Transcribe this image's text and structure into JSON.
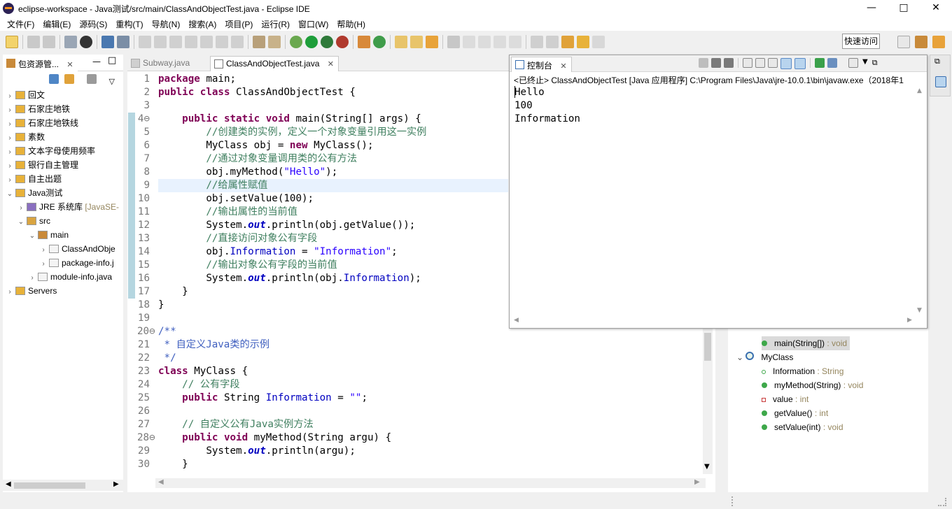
{
  "window": {
    "title": "eclipse-workspace - Java测试/src/main/ClassAndObjectTest.java - Eclipse IDE",
    "minimize_glyph": "—",
    "maximize_glyph": "□",
    "close_glyph": "✕"
  },
  "menu": [
    "文件(F)",
    "编辑(E)",
    "源码(S)",
    "重构(T)",
    "导航(N)",
    "搜索(A)",
    "项目(P)",
    "运行(R)",
    "窗口(W)",
    "帮助(H)"
  ],
  "toolbar": {
    "quick_access": "快速访问"
  },
  "package_explorer": {
    "tab_label": "包资源管...",
    "items": [
      {
        "label": "回文",
        "depth": 0,
        "expanded": false,
        "kind": "project"
      },
      {
        "label": "石家庄地铁",
        "depth": 0,
        "expanded": false,
        "kind": "project"
      },
      {
        "label": "石家庄地铁线",
        "depth": 0,
        "expanded": false,
        "kind": "project"
      },
      {
        "label": "素数",
        "depth": 0,
        "expanded": false,
        "kind": "project"
      },
      {
        "label": "文本字母使用频率",
        "depth": 0,
        "expanded": false,
        "kind": "project"
      },
      {
        "label": "银行自主管理",
        "depth": 0,
        "expanded": false,
        "kind": "project"
      },
      {
        "label": "自主出题",
        "depth": 0,
        "expanded": false,
        "kind": "project"
      },
      {
        "label": "Java测试",
        "depth": 0,
        "expanded": true,
        "kind": "project"
      },
      {
        "label": "JRE 系统库",
        "suffix": "[JavaSE-",
        "depth": 1,
        "expanded": false,
        "kind": "library"
      },
      {
        "label": "src",
        "depth": 1,
        "expanded": true,
        "kind": "folder"
      },
      {
        "label": "main",
        "depth": 2,
        "expanded": true,
        "kind": "package"
      },
      {
        "label": "ClassAndObje",
        "depth": 3,
        "expanded": false,
        "kind": "file"
      },
      {
        "label": "package-info.j",
        "depth": 3,
        "expanded": false,
        "kind": "file"
      },
      {
        "label": "module-info.java",
        "depth": 2,
        "expanded": false,
        "kind": "file"
      },
      {
        "label": "Servers",
        "depth": 0,
        "expanded": false,
        "kind": "project"
      }
    ]
  },
  "editor": {
    "tabs": [
      "Subway.java",
      "ClassAndObjectTest.java"
    ],
    "active_tab": "ClassAndObjectTest.java",
    "close_glyph": "✕",
    "lines": [
      {
        "n": "1",
        "segs": [
          [
            "kw",
            "package"
          ],
          [
            "p",
            " main;"
          ]
        ]
      },
      {
        "n": "2",
        "segs": [
          [
            "kw",
            "public"
          ],
          [
            "p",
            " "
          ],
          [
            "kw",
            "class"
          ],
          [
            "p",
            " ClassAndObjectTest {"
          ]
        ]
      },
      {
        "n": "3",
        "segs": []
      },
      {
        "n": "4⊖",
        "segs": [
          [
            "p",
            "    "
          ],
          [
            "kw",
            "public"
          ],
          [
            "p",
            " "
          ],
          [
            "kw",
            "static"
          ],
          [
            "p",
            " "
          ],
          [
            "kw",
            "void"
          ],
          [
            "p",
            " main(String[] args) {"
          ]
        ]
      },
      {
        "n": "5",
        "segs": [
          [
            "p",
            "        "
          ],
          [
            "cmt",
            "//创建类的实例，定义一个对象变量引用这一实例"
          ]
        ]
      },
      {
        "n": "6",
        "segs": [
          [
            "p",
            "        MyClass obj = "
          ],
          [
            "kw",
            "new"
          ],
          [
            "p",
            " MyClass();"
          ]
        ]
      },
      {
        "n": "7",
        "segs": [
          [
            "p",
            "        "
          ],
          [
            "cmt",
            "//通过对象变量调用类的公有方法"
          ]
        ]
      },
      {
        "n": "8",
        "segs": [
          [
            "p",
            "        obj.myMethod("
          ],
          [
            "str",
            "\"Hello\""
          ],
          [
            "p",
            ");"
          ]
        ]
      },
      {
        "n": "9",
        "segs": [
          [
            "p",
            "        "
          ],
          [
            "cmt",
            "//给属性赋值"
          ]
        ]
      },
      {
        "n": "10",
        "segs": [
          [
            "p",
            "        obj.setValue(100);"
          ]
        ]
      },
      {
        "n": "11",
        "segs": [
          [
            "p",
            "        "
          ],
          [
            "cmt",
            "//输出属性的当前值"
          ]
        ]
      },
      {
        "n": "12",
        "segs": [
          [
            "p",
            "        System."
          ],
          [
            "sfld",
            "out"
          ],
          [
            "p",
            ".println(obj.getValue());"
          ]
        ]
      },
      {
        "n": "13",
        "segs": [
          [
            "p",
            "        "
          ],
          [
            "cmt",
            "//直接访问对象公有字段"
          ]
        ]
      },
      {
        "n": "14",
        "segs": [
          [
            "p",
            "        obj."
          ],
          [
            "fld",
            "Information"
          ],
          [
            "p",
            " = "
          ],
          [
            "str",
            "\"Information\""
          ],
          [
            "p",
            ";"
          ]
        ]
      },
      {
        "n": "15",
        "segs": [
          [
            "p",
            "        "
          ],
          [
            "cmt",
            "//输出对象公有字段的当前值"
          ]
        ]
      },
      {
        "n": "16",
        "segs": [
          [
            "p",
            "        System."
          ],
          [
            "sfld",
            "out"
          ],
          [
            "p",
            ".println(obj."
          ],
          [
            "fld",
            "Information"
          ],
          [
            "p",
            ");"
          ]
        ]
      },
      {
        "n": "17",
        "segs": [
          [
            "p",
            "    }"
          ]
        ]
      },
      {
        "n": "18",
        "segs": [
          [
            "p",
            "}"
          ]
        ]
      },
      {
        "n": "19",
        "segs": []
      },
      {
        "n": "20⊖",
        "segs": [
          [
            "doc",
            "/**"
          ]
        ]
      },
      {
        "n": "21",
        "segs": [
          [
            "doc",
            " * 自定义Java类的示例"
          ]
        ]
      },
      {
        "n": "22",
        "segs": [
          [
            "doc",
            " */"
          ]
        ]
      },
      {
        "n": "23",
        "segs": [
          [
            "kw",
            "class"
          ],
          [
            "p",
            " MyClass {"
          ]
        ]
      },
      {
        "n": "24",
        "segs": [
          [
            "p",
            "    "
          ],
          [
            "cmt",
            "// 公有字段"
          ]
        ]
      },
      {
        "n": "25",
        "segs": [
          [
            "p",
            "    "
          ],
          [
            "kw",
            "public"
          ],
          [
            "p",
            " String "
          ],
          [
            "fld",
            "Information"
          ],
          [
            "p",
            " = "
          ],
          [
            "str",
            "\"\""
          ],
          [
            "p",
            ";"
          ]
        ]
      },
      {
        "n": "26",
        "segs": []
      },
      {
        "n": "27",
        "segs": [
          [
            "p",
            "    "
          ],
          [
            "cmt",
            "// 自定义公有Java实例方法"
          ]
        ]
      },
      {
        "n": "28⊖",
        "segs": [
          [
            "p",
            "    "
          ],
          [
            "kw",
            "public"
          ],
          [
            "p",
            " "
          ],
          [
            "kw",
            "void"
          ],
          [
            "p",
            " myMethod(String argu) {"
          ]
        ]
      },
      {
        "n": "29",
        "segs": [
          [
            "p",
            "        System."
          ],
          [
            "sfld",
            "out"
          ],
          [
            "p",
            ".println(argu);"
          ]
        ]
      },
      {
        "n": "30",
        "segs": [
          [
            "p",
            "    }"
          ]
        ]
      }
    ]
  },
  "console": {
    "tab_label": "控制台",
    "header": "<已终止> ClassAndObjectTest [Java 应用程序] C:\\Program Files\\Java\\jre-10.0.1\\bin\\javaw.exe（2018年1",
    "output": [
      "Hello",
      "100",
      "Information"
    ]
  },
  "outline": {
    "items": [
      {
        "label": "main(String[])",
        "type": " : void",
        "depth": 1,
        "kind": "method-static",
        "selected": true
      },
      {
        "label": "MyClass",
        "type": "",
        "depth": 0,
        "kind": "class"
      },
      {
        "label": "Information",
        "type": " : String",
        "depth": 1,
        "kind": "field-public"
      },
      {
        "label": "myMethod(String)",
        "type": " : void",
        "depth": 1,
        "kind": "method-public"
      },
      {
        "label": "value",
        "type": " : int",
        "depth": 1,
        "kind": "field-private"
      },
      {
        "label": "getValue()",
        "type": " : int",
        "depth": 1,
        "kind": "method-public"
      },
      {
        "label": "setValue(int)",
        "type": " : void",
        "depth": 1,
        "kind": "method-public"
      }
    ]
  },
  "colors": {
    "keyword": "#7f0055",
    "string": "#2a00ff",
    "comment": "#3f7f5f",
    "field": "#0000c0",
    "javadoc": "#3f5fbf",
    "highlight_line": "#e8f2fe"
  }
}
